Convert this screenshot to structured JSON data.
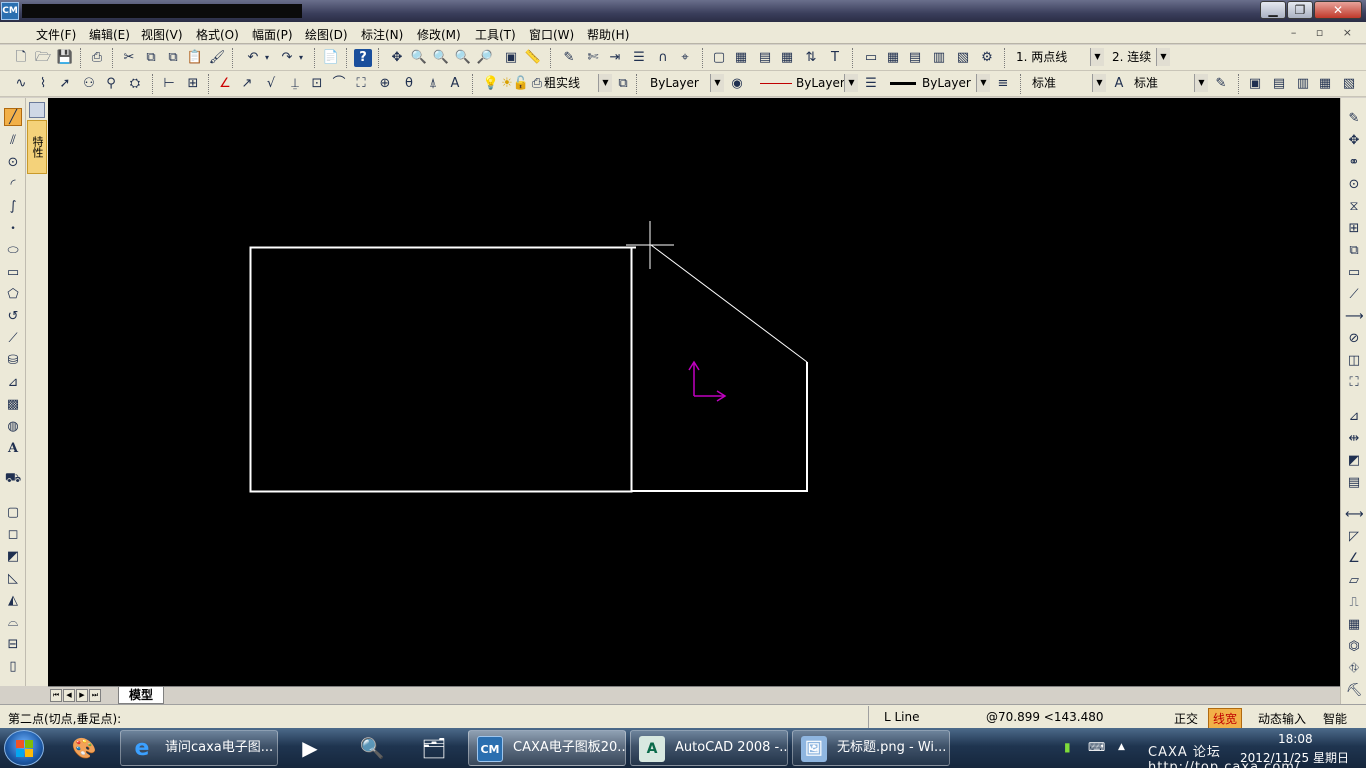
{
  "window": {
    "app_icon_text": "CM",
    "controls": {
      "minimize": "▁",
      "maximize": "❐",
      "close": "✕"
    }
  },
  "menu": {
    "items": [
      "文件(F)",
      "编辑(E)",
      "视图(V)",
      "格式(O)",
      "幅面(P)",
      "绘图(D)",
      "标注(N)",
      "修改(M)",
      "工具(T)",
      "窗口(W)",
      "帮助(H)"
    ],
    "mdi_controls": "– ▫ ×"
  },
  "toolbar1": {
    "mode1": "1. 两点线",
    "mode2": "2. 连续"
  },
  "toolbar2": {
    "linetype": "粗实线",
    "color": "ByLayer",
    "line_style": "ByLayer",
    "line_weight": "ByLayer",
    "text_style": "标准",
    "dim_style": "标准"
  },
  "side_panel": {
    "tab_label": "特性"
  },
  "tabs": {
    "model": "模型"
  },
  "status": {
    "prompt": "第二点(切点,垂足点):",
    "command": "L Line",
    "coordinates": "@70.899 <143.480",
    "ortho": "正交",
    "lineweight": "线宽",
    "dynamic_input": "动态输入",
    "smart": "智能"
  },
  "taskbar": {
    "tasks": [
      {
        "label": "请问caxa电子图...",
        "icon": "internet-explorer-icon"
      },
      {
        "label": "CAXA电子图板20...",
        "icon": "caxa-icon"
      },
      {
        "label": "AutoCAD 2008 -...",
        "icon": "autocad-icon"
      },
      {
        "label": "无标题.png - Wi...",
        "icon": "paint-icon"
      }
    ],
    "tray_watermark": "CAXA 论坛 http://top.caxa.com/",
    "clock_time": "18:08",
    "clock_date": "2012/11/25 星期日"
  },
  "colors": {
    "canvas": "#000000",
    "geometry": "#ffffff",
    "ucs_axis": "#c000c0",
    "linetype_swatch": "#c00000",
    "lineweight_active": "#f2b048"
  }
}
